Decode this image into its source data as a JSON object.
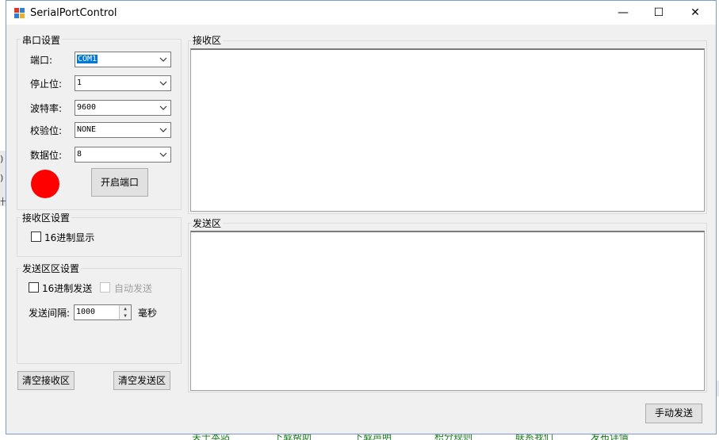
{
  "window": {
    "title": "SerialPortControl"
  },
  "titlebar": {
    "minimize": "—",
    "maximize": "☐",
    "close": "✕"
  },
  "serial": {
    "group_title": "串口设置",
    "port_label": "端口:",
    "port_value": "COM1",
    "stopbits_label": "停止位:",
    "stopbits_value": "1",
    "baud_label": "波特率:",
    "baud_value": "9600",
    "parity_label": "校验位:",
    "parity_value": "NONE",
    "databits_label": "数据位:",
    "databits_value": "8",
    "open_button": "开启端口",
    "status_color": "#ff0000"
  },
  "receive_settings": {
    "group_title": "接收区设置",
    "hex_display_label": "16进制显示",
    "hex_display_checked": false
  },
  "send_settings": {
    "group_title": "发送区区设置",
    "hex_send_label": "16进制发送",
    "hex_send_checked": false,
    "auto_send_label": "自动发送",
    "auto_send_enabled": false,
    "interval_label": "发送间隔:",
    "interval_value": "1000",
    "interval_unit": "毫秒"
  },
  "buttons": {
    "clear_receive": "清空接收区",
    "clear_send": "清空发送区",
    "manual_send": "手动发送"
  },
  "receive_area": {
    "title": "接收区",
    "content": ""
  },
  "send_area": {
    "title": "发送区",
    "content": ""
  },
  "background": {
    "left_fragments": [
      ")",
      ")",
      "卄"
    ],
    "bottom_links": [
      "关于本站",
      "下载帮助",
      "下载声明",
      "积分规则",
      "联系我们",
      "发布详情"
    ]
  }
}
